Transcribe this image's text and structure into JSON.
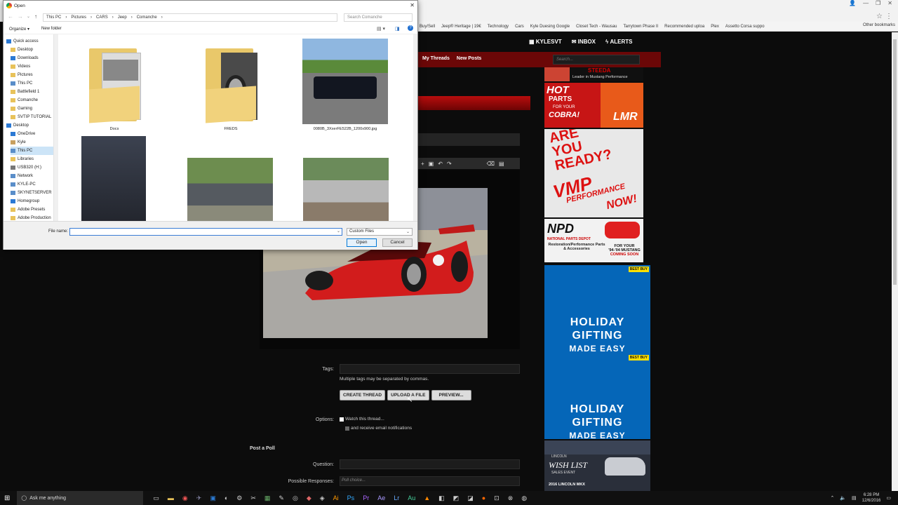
{
  "bookmarks": [
    "Buy/Sell",
    "Jeep® Heritage | 19€",
    "Technology",
    "Cars",
    "Kyle Duesing Google",
    "Closet Tech - Wausau",
    "Tarrytown Phase II",
    "Recommended uploa",
    "Plex",
    "Assetto Corsa suppo"
  ],
  "other_bookmarks": "Other bookmarks",
  "site": {
    "user": "KYLESVT",
    "inbox": "INBOX",
    "alerts": "ALERTS",
    "nav": [
      "My Threads",
      "New Posts"
    ],
    "search_placeholder": "Search...",
    "form": {
      "tags_label": "Tags:",
      "tags_hint": "Multiple tags may be separated by commas.",
      "buttons": {
        "create": "CREATE THREAD",
        "upload": "UPLOAD A FILE",
        "preview": "PREVIEW..."
      },
      "options_label": "Options:",
      "watch": "Watch this thread...",
      "email": "and receive email notifications",
      "poll_heading": "Post a Poll",
      "question_label": "Question:",
      "responses_label": "Possible Responses:",
      "responses_placeholder": "Poll choice..."
    }
  },
  "ads": {
    "steeda": {
      "brand": "STEEDA",
      "tagline": "Leader in Mustang Performance"
    },
    "lmr": {
      "line1": "HOT",
      "line2": "PARTS",
      "line3": "FOR YOUR",
      "line4": "COBRA!",
      "brand": "LMR"
    },
    "vmp": {
      "line1": "ARE",
      "line2": "YOU",
      "line3": "READY?",
      "brand": "VMP",
      "line4": "PERFORMANCE",
      "line5": "NOW!"
    },
    "npd": {
      "brand": "NPD",
      "name": "NATIONAL PARTS DEPOT",
      "desc": "Restoration/Performance Parts & Accessories",
      "tag1": "FOR YOUR",
      "tag2": "'94-'04 MUSTANG",
      "tag3": "COMING SOON"
    },
    "bestbuy": {
      "logo": "BEST BUY",
      "line1": "HOLIDAY",
      "line2": "GIFTING",
      "line3": "MADE EASY"
    },
    "lincoln": {
      "brand": "LINCOLN",
      "title": "WISH LIST",
      "sub": "SALES EVENT",
      "model": "2016 LINCOLN MKX"
    }
  },
  "dialog": {
    "title": "Open",
    "breadcrumb": [
      "This PC",
      "Pictures",
      "CARS",
      "Jeep",
      "Comanche"
    ],
    "search_placeholder": "Search Comanche",
    "organize": "Organize ▾",
    "new_folder": "New folder",
    "nav_items": [
      {
        "label": "Quick access",
        "icon": "star-icon",
        "group": true
      },
      {
        "label": "Desktop",
        "icon": "folder-icon"
      },
      {
        "label": "Downloads",
        "icon": "download-icon"
      },
      {
        "label": "Videos",
        "icon": "folder-icon"
      },
      {
        "label": "Pictures",
        "icon": "folder-icon"
      },
      {
        "label": "This PC",
        "icon": "pc-icon"
      },
      {
        "label": "Battlefield 1",
        "icon": "folder-icon"
      },
      {
        "label": "Comanche",
        "icon": "folder-icon"
      },
      {
        "label": "Gaming",
        "icon": "folder-icon"
      },
      {
        "label": "SVTIP TUTORIAL",
        "icon": "folder-icon"
      },
      {
        "label": "Desktop",
        "icon": "desktop-icon",
        "group": true
      },
      {
        "label": "OneDrive",
        "icon": "cloud-icon"
      },
      {
        "label": "Kyle",
        "icon": "user-icon"
      },
      {
        "label": "This PC",
        "icon": "pc-icon",
        "selected": true
      },
      {
        "label": "Libraries",
        "icon": "folder-icon"
      },
      {
        "label": "USB320 (H:)",
        "icon": "drive-icon"
      },
      {
        "label": "Network",
        "icon": "network-icon"
      },
      {
        "label": "KYLE-PC",
        "icon": "pc-icon"
      },
      {
        "label": "SKYNETSERVER",
        "icon": "pc-icon"
      },
      {
        "label": "Homegroup",
        "icon": "homegroup-icon"
      },
      {
        "label": "Adobe Presets",
        "icon": "folder-icon"
      },
      {
        "label": "Adobe Production",
        "icon": "folder-icon"
      }
    ],
    "files": [
      "Docs",
      "FREDS",
      "0080B_3XxerFE522B_1200x900.jpg"
    ],
    "filename_label": "File name:",
    "filename_value": "",
    "filetype": "Custom Files",
    "open_button": "Open",
    "cancel_button": "Cancel"
  },
  "taskbar": {
    "search_placeholder": "Ask me anything",
    "time": "6:28 PM",
    "date": "12/6/2016"
  }
}
